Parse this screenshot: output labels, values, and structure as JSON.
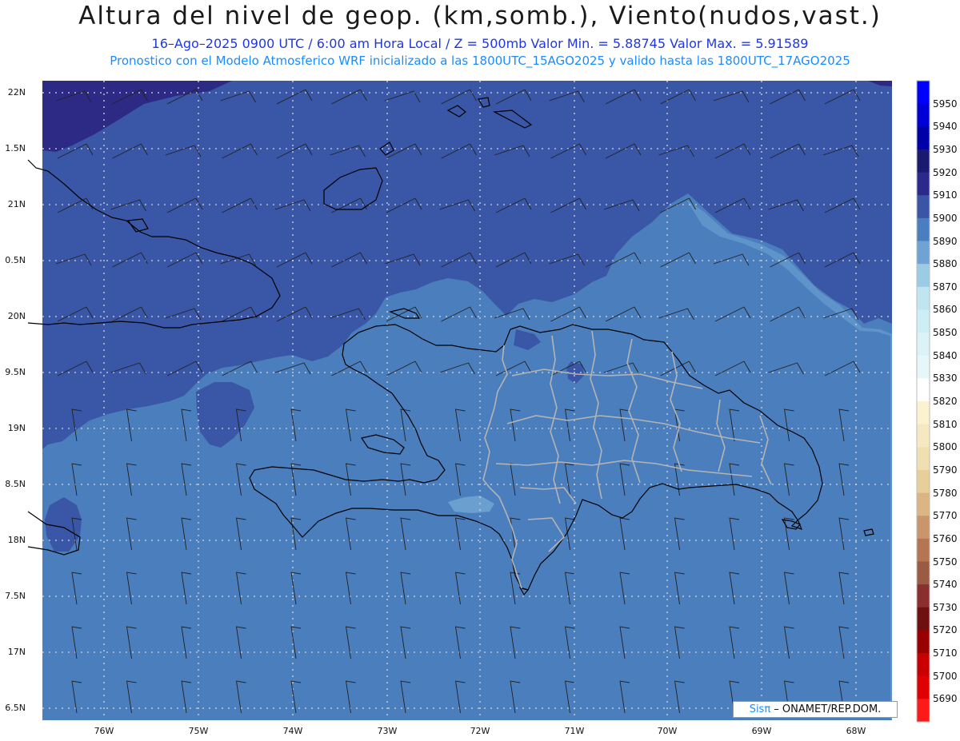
{
  "header": {
    "title": "Altura del nivel de geop. (km,somb.), Viento(nudos,vast.)",
    "subtitle1": "16–Ago–2025  0900 UTC / 6:00 am Hora Local / Z = 500mb    Valor Min. = 5.88745  Valor Max. = 5.91589",
    "subtitle2": "Pronostico con el Modelo Atmosferico WRF inicializado a las 1800UTC_15AGO2025 y valido hasta las  1800UTC_17AGO2025"
  },
  "axes": {
    "lat_labels": [
      "22N",
      "1.5N",
      "21N",
      "0.5N",
      "20N",
      "9.5N",
      "19N",
      "8.5N",
      "18N",
      "7.5N",
      "17N",
      "6.5N"
    ],
    "lon_labels": [
      "76W",
      "75W",
      "74W",
      "73W",
      "72W",
      "71W",
      "70W",
      "69W",
      "68W"
    ]
  },
  "colorbar": {
    "labels": [
      "5950",
      "5940",
      "5930",
      "5920",
      "5910",
      "5900",
      "5890",
      "5880",
      "5870",
      "5860",
      "5850",
      "5840",
      "5830",
      "5820",
      "5810",
      "5800",
      "5790",
      "5780",
      "5770",
      "5760",
      "5750",
      "5740",
      "5730",
      "5720",
      "5710",
      "5700",
      "5690"
    ],
    "colors": [
      "#0000ff",
      "#0000d6",
      "#0000a8",
      "#1a1a6e",
      "#2b2a8c",
      "#3b55a6",
      "#4a7fbf",
      "#6fa3d4",
      "#9ccbe6",
      "#bfe6f0",
      "#cdeef4",
      "#dbf3f7",
      "#e6f7fa",
      "#ffffff",
      "#fbf2d0",
      "#f6e8c0",
      "#f0dfb0",
      "#e8cf9a",
      "#dbb682",
      "#c9956a",
      "#b57552",
      "#9b5a44",
      "#8a2e2e",
      "#6e1010",
      "#990000",
      "#c80000",
      "#e00000",
      "#ff1a1a"
    ]
  },
  "legend": {
    "fill_colors": {
      "5910": "#2c2a85",
      "5900": "#3a56a6",
      "5890": "#4b7ebd",
      "5880": "#6a9fd0"
    }
  },
  "credit": {
    "brand": "Sisπ",
    "org": " – ONAMET/REP.DOM."
  },
  "colors": {
    "coastline": "#000000",
    "provinces": "#b4b4b4",
    "grid": "#d6d6d6",
    "barbs": "#222222"
  }
}
